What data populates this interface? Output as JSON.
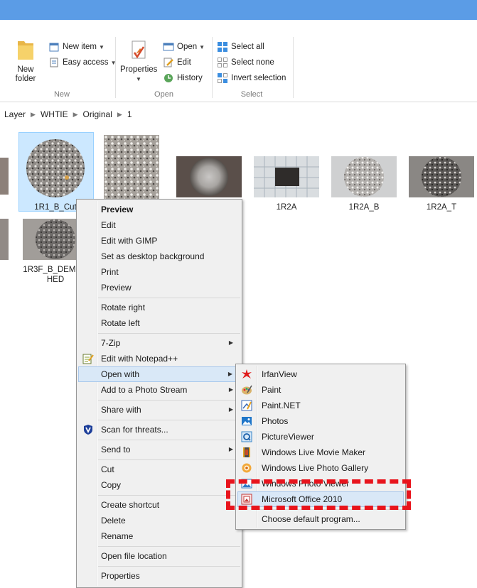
{
  "ribbon": {
    "new_group": {
      "label": "New",
      "new_folder": "New\nfolder",
      "new_item": "New item",
      "easy_access": "Easy access"
    },
    "open_group": {
      "label": "Open",
      "properties": "Properties",
      "open": "Open",
      "edit": "Edit",
      "history": "History"
    },
    "select_group": {
      "label": "Select",
      "select_all": "Select all",
      "select_none": "Select none",
      "invert_selection": "Invert selection"
    }
  },
  "breadcrumb": [
    "Layer",
    "WHTIE",
    "Original",
    "1"
  ],
  "files": [
    {
      "name": "1R1_B_Cut"
    },
    {
      "name": "1R2A"
    },
    {
      "name": "1R2A_B"
    },
    {
      "name": "1R2A_T"
    },
    {
      "name": "1R3F_B_DEMOC\nHED"
    }
  ],
  "context_menu": [
    {
      "label": "Preview",
      "bold": true
    },
    {
      "label": "Edit"
    },
    {
      "label": "Edit with GIMP"
    },
    {
      "label": "Set as desktop background"
    },
    {
      "label": "Print"
    },
    {
      "label": "Preview"
    },
    {
      "label": "Rotate right"
    },
    {
      "label": "Rotate left"
    },
    {
      "label": "7-Zip"
    },
    {
      "label": "Edit with Notepad++"
    },
    {
      "label": "Open with"
    },
    {
      "label": "Add to a Photo Stream"
    },
    {
      "label": "Share with"
    },
    {
      "label": "Scan for threats..."
    },
    {
      "label": "Send to"
    },
    {
      "label": "Cut"
    },
    {
      "label": "Copy"
    },
    {
      "label": "Create shortcut"
    },
    {
      "label": "Delete"
    },
    {
      "label": "Rename"
    },
    {
      "label": "Open file location"
    },
    {
      "label": "Properties"
    }
  ],
  "open_with_menu": [
    {
      "label": "IrfanView"
    },
    {
      "label": "Paint"
    },
    {
      "label": "Paint.NET"
    },
    {
      "label": "Photos"
    },
    {
      "label": "PictureViewer"
    },
    {
      "label": "Windows Live Movie Maker"
    },
    {
      "label": "Windows Live Photo Gallery"
    },
    {
      "label": "Windows Photo Viewer"
    },
    {
      "label": "Microsoft Office 2010"
    },
    {
      "label": "Choose default program..."
    }
  ],
  "colors": {
    "titlebar": "#5b9ce6",
    "highlight_annotation": "#e8141c",
    "selection": "#cce8ff"
  }
}
